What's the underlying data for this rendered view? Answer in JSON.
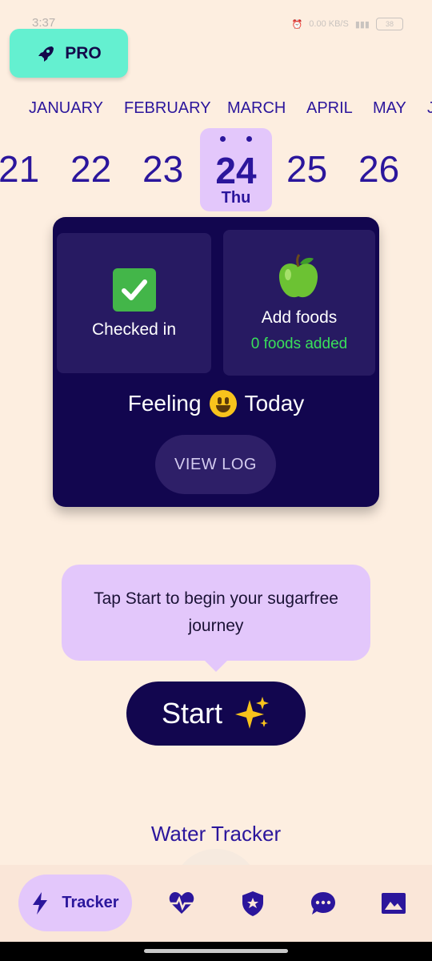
{
  "status": {
    "time": "3:37",
    "net_speed": "0.00 KB/S",
    "battery": "38"
  },
  "pro_button": {
    "label": "PRO",
    "icon": "rocket-icon"
  },
  "months": [
    "JANUARY",
    "FEBRUARY",
    "MARCH",
    "APRIL",
    "MAY",
    "J"
  ],
  "days": {
    "before": [
      "21",
      "22",
      "23"
    ],
    "selected": {
      "number": "24",
      "weekday": "Thu"
    },
    "after": [
      "25",
      "26"
    ]
  },
  "summary_card": {
    "checkin": {
      "icon": "check-mark-icon",
      "label": "Checked in"
    },
    "foods": {
      "icon": "apple-icon",
      "label": "Add foods",
      "count_text": "0 foods added"
    },
    "feeling": {
      "prefix": "Feeling",
      "emoji": "smiley-icon",
      "suffix": "Today"
    },
    "view_log_label": "VIEW LOG"
  },
  "tooltip": {
    "text": "Tap Start to begin your sugarfree journey"
  },
  "start_button": {
    "label": "Start",
    "icon": "sparkles-icon"
  },
  "water_tracker": {
    "title": "Water Tracker"
  },
  "bottom_nav": {
    "active_label": "Tracker",
    "items": [
      "tracker",
      "heart-rate",
      "badge",
      "chat",
      "gallery"
    ]
  },
  "colors": {
    "background": "#fdeee0",
    "primary_dark": "#12064f",
    "accent_purple": "#2b169c",
    "lavender": "#e3c7fb",
    "mint": "#64f0d0",
    "green_text": "#39e05a"
  }
}
